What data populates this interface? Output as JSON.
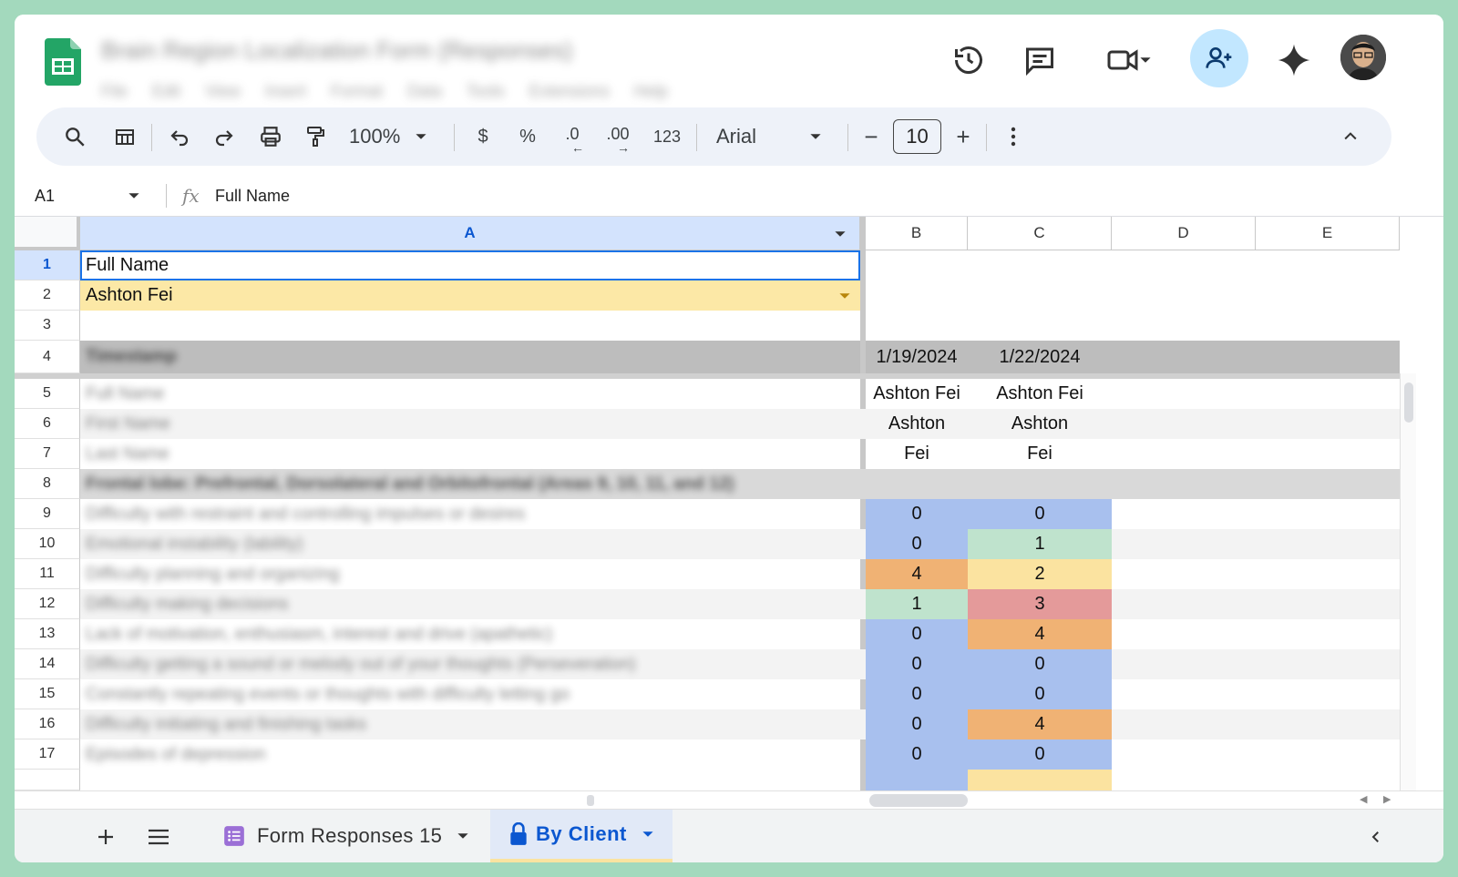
{
  "app": {
    "doc_title": "Brain Region Localization Form (Responses)",
    "menu_items": [
      "File",
      "Edit",
      "View",
      "Insert",
      "Format",
      "Data",
      "Tools",
      "Extensions",
      "Help"
    ]
  },
  "toolbar": {
    "zoom": "100%",
    "currency": "$",
    "percent": "%",
    "dec_decrease": ".0",
    "dec_increase": ".00",
    "number_format": "123",
    "font": "Arial",
    "font_size": "10",
    "minus": "−",
    "plus": "+"
  },
  "formula_bar": {
    "cell_ref": "A1",
    "fx": "fx",
    "content": "Full Name"
  },
  "columns": [
    "A",
    "B",
    "C",
    "D",
    "E"
  ],
  "rows": {
    "r1": {
      "num": "1",
      "a": "Full Name"
    },
    "r2": {
      "num": "2",
      "a": "Ashton Fei"
    },
    "r3": {
      "num": "3"
    },
    "r4": {
      "num": "4",
      "a": "Timestamp",
      "b": "1/19/2024",
      "c": "1/22/2024"
    },
    "r5": {
      "num": "5",
      "a": "Full Name",
      "b": "Ashton Fei",
      "c": "Ashton Fei"
    },
    "r6": {
      "num": "6",
      "a": "First Name",
      "b": "Ashton",
      "c": "Ashton"
    },
    "r7": {
      "num": "7",
      "a": "Last Name",
      "b": "Fei",
      "c": "Fei"
    },
    "r8": {
      "num": "8",
      "a": "Frontal lobe: Prefrontal, Dorsolateral and Orbitofrontal (Areas 9, 10, 11, and 12)"
    },
    "r9": {
      "num": "9",
      "a": "Difficulty with restraint and controlling impulses or desires",
      "b": "0",
      "c": "0"
    },
    "r10": {
      "num": "10",
      "a": "Emotional instability (lability)",
      "b": "0",
      "c": "1"
    },
    "r11": {
      "num": "11",
      "a": "Difficulty planning and organizing",
      "b": "4",
      "c": "2"
    },
    "r12": {
      "num": "12",
      "a": "Difficulty making decisions",
      "b": "1",
      "c": "3"
    },
    "r13": {
      "num": "13",
      "a": "Lack of motivation, enthusiasm, interest and drive (apathetic)",
      "b": "0",
      "c": "4"
    },
    "r14": {
      "num": "14",
      "a": "Difficulty getting a sound or melody out of your thoughts (Perseveration)",
      "b": "0",
      "c": "0"
    },
    "r15": {
      "num": "15",
      "a": "Constantly repeating events or thoughts with difficulty letting go",
      "b": "0",
      "c": "0"
    },
    "r16": {
      "num": "16",
      "a": "Difficulty initiating and finishing tasks",
      "b": "0",
      "c": "4"
    },
    "r17": {
      "num": "17",
      "a": "Episodes of depression",
      "b": "0",
      "c": "0"
    }
  },
  "scale_colors": {
    "0": "#a8c0ee",
    "1": "#bfe3cd",
    "2": "#fbe3a0",
    "3": "#e49a9a",
    "4": "#f0b274"
  },
  "sheet_tabs": {
    "tab1": "Form Responses 15",
    "tab2": "By Client"
  }
}
